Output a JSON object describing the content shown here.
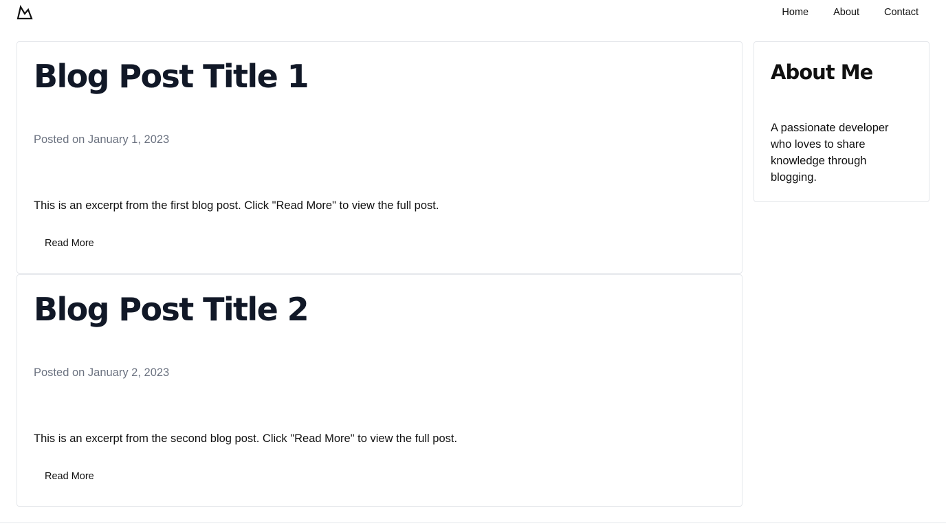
{
  "nav": {
    "logo_icon": "mountain-logo-icon",
    "links": [
      "Home",
      "About",
      "Contact"
    ]
  },
  "posts": [
    {
      "title": "Blog Post Title 1",
      "date": "Posted on January 1, 2023",
      "excerpt": "This is an excerpt from the first blog post. Click \"Read More\" to view the full post.",
      "button": "Read More"
    },
    {
      "title": "Blog Post Title 2",
      "date": "Posted on January 2, 2023",
      "excerpt": "This is an excerpt from the second blog post. Click \"Read More\" to view the full post.",
      "button": "Read More"
    }
  ],
  "sidebar": {
    "title": "About Me",
    "text": "A passionate developer who loves to share knowledge through blogging."
  },
  "colors": {
    "title": "#111827",
    "muted": "#6b7280",
    "border": "#e5e7eb"
  }
}
